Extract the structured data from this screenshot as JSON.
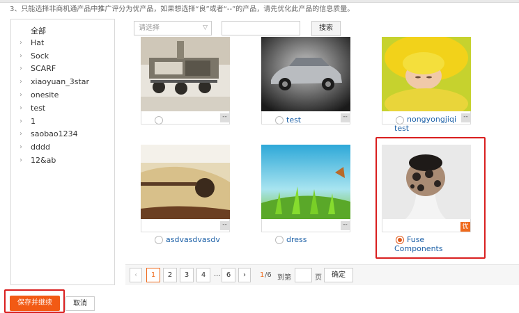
{
  "notice": "3、只能选择非商机通产品中推广评分为优产品，如果想选择“良”或者“--”的产品，请先优化此产品的信息质量。",
  "sidebar": {
    "all_label": "全部",
    "items": [
      {
        "label": "Hat"
      },
      {
        "label": "Sock"
      },
      {
        "label": "SCARF"
      },
      {
        "label": "xiaoyuan_3star"
      },
      {
        "label": "onesite"
      },
      {
        "label": "test"
      },
      {
        "label": "1"
      },
      {
        "label": "saobao1234"
      },
      {
        "label": "dddd"
      },
      {
        "label": "12&ab"
      }
    ]
  },
  "search": {
    "select_placeholder": "请选择",
    "text_value": "",
    "button": "搜索"
  },
  "products": [
    {
      "name": "",
      "score": "--",
      "selected": false,
      "image": "mars-rover"
    },
    {
      "name": "test",
      "score": "--",
      "selected": false,
      "image": "silver-car"
    },
    {
      "name": "nongyongjiqi test",
      "score": "--",
      "selected": false,
      "image": "sleeping-baby"
    },
    {
      "name": "asdvasdvasdv",
      "score": "--",
      "selected": false,
      "image": "guitar"
    },
    {
      "name": "dress",
      "score": "--",
      "selected": false,
      "image": "grass-butterfly"
    },
    {
      "name": "Fuse Components",
      "score": "优",
      "selected": true,
      "image": "knitted-hat"
    }
  ],
  "pagination": {
    "prev": "‹",
    "pages": [
      "1",
      "2",
      "3",
      "4",
      "6"
    ],
    "current": "1",
    "ellipsis": "...",
    "next": "›",
    "current_of": "1",
    "total": "/6",
    "goto_prefix": "到第",
    "goto_suffix": "页",
    "goto_value": "",
    "confirm": "确定"
  },
  "actions": {
    "save": "保存并继续",
    "cancel": "取消"
  },
  "colors": {
    "accent": "#f25a14",
    "highlight": "#d91f1f",
    "link": "#1f62a8"
  }
}
